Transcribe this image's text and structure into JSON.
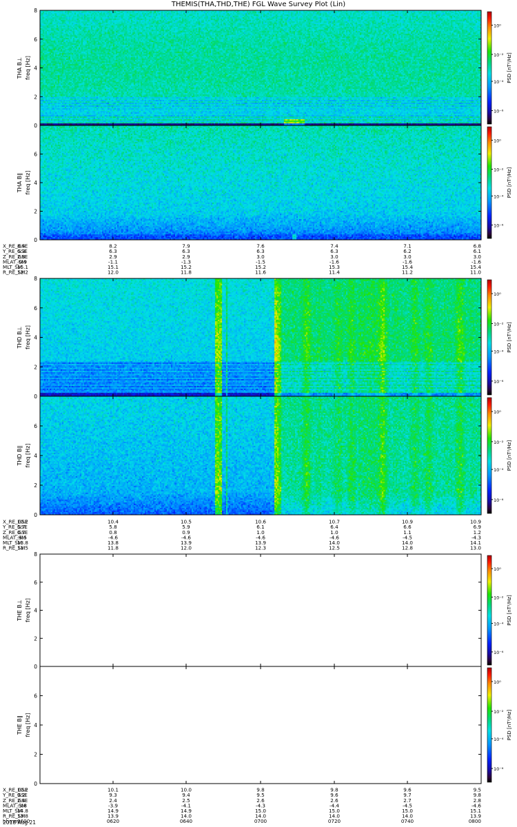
{
  "title": "THEMIS(THA,THD,THE) FGL Wave Survey Plot (Lin)",
  "date_label": "2018 Aug 21",
  "colorbar_label": "PSD [nT²/Hz]",
  "colorbar_ticks": [
    "10⁰",
    "10⁻²",
    "10⁻⁴",
    "10⁻⁶"
  ],
  "chart_data": [
    {
      "type": "heatmap",
      "panel": "THA B⊥",
      "ylabel_top": "THA B⊥",
      "ylabel": "freq [Hz]",
      "ylim": [
        0,
        8
      ],
      "yticks": [
        0,
        2,
        4,
        6,
        8
      ],
      "pattern": "tha_perp",
      "has_data": true
    },
    {
      "type": "heatmap",
      "panel": "THA B∥",
      "ylabel_top": "THA B∥",
      "ylabel": "freq [Hz]",
      "ylim": [
        0,
        8
      ],
      "yticks": [
        0,
        2,
        4,
        6
      ],
      "pattern": "tha_par",
      "has_data": true
    },
    {
      "type": "heatmap",
      "panel": "THD B⊥",
      "ylabel_top": "THD B⊥",
      "ylabel": "freq [Hz]",
      "ylim": [
        0,
        8
      ],
      "yticks": [
        0,
        2,
        4,
        6,
        8
      ],
      "pattern": "thd_perp",
      "has_data": true
    },
    {
      "type": "heatmap",
      "panel": "THD B∥",
      "ylabel_top": "THD B∥",
      "ylabel": "freq [Hz]",
      "ylim": [
        0,
        8
      ],
      "yticks": [
        0,
        2,
        4,
        6
      ],
      "pattern": "thd_par",
      "has_data": true
    },
    {
      "type": "heatmap",
      "panel": "THE B⊥",
      "ylabel_top": "THE B⊥",
      "ylabel": "freq [Hz]",
      "ylim": [
        0,
        8
      ],
      "yticks": [
        0,
        2,
        4,
        6,
        8
      ],
      "pattern": "empty",
      "has_data": false
    },
    {
      "type": "heatmap",
      "panel": "THE B∥",
      "ylabel_top": "THE B∥",
      "ylabel": "freq [Hz]",
      "ylim": [
        0,
        8
      ],
      "yticks": [
        0,
        2,
        4,
        6
      ],
      "pattern": "empty",
      "has_data": false
    }
  ],
  "ephemeris": [
    {
      "rows": [
        {
          "label": "X_RE_GSE",
          "values": [
            "8.4",
            "8.2",
            "7.9",
            "7.6",
            "7.4",
            "7.1",
            "6.8"
          ]
        },
        {
          "label": "Y_RE_GSE",
          "values": [
            "6.3",
            "6.3",
            "6.3",
            "6.3",
            "6.3",
            "6.2",
            "6.1"
          ]
        },
        {
          "label": "Z_RE_GSE",
          "values": [
            "2.8",
            "2.9",
            "2.9",
            "3.0",
            "3.0",
            "3.0",
            "3.0"
          ]
        },
        {
          "label": "MLAT_SM",
          "values": [
            "-0.9",
            "-1.1",
            "-1.3",
            "-1.5",
            "-1.6",
            "-1.6",
            "-1.6"
          ]
        },
        {
          "label": "MLT_SM",
          "values": [
            "15.1",
            "15.1",
            "15.2",
            "15.2",
            "15.3",
            "15.4",
            "15.4"
          ]
        },
        {
          "label": "R_RE_SM",
          "values": [
            "12.2",
            "12.0",
            "11.8",
            "11.6",
            "11.4",
            "11.2",
            "11.0"
          ]
        }
      ]
    },
    {
      "rows": [
        {
          "label": "X_RE_GSE",
          "values": [
            "10.2",
            "10.4",
            "10.5",
            "10.6",
            "10.7",
            "10.9",
            "10.9"
          ]
        },
        {
          "label": "Y_RE_GSE",
          "values": [
            "5.7",
            "5.8",
            "5.9",
            "6.1",
            "6.4",
            "6.6",
            "6.9"
          ]
        },
        {
          "label": "Z_RE_GSE",
          "values": [
            "0.7",
            "0.8",
            "0.9",
            "1.0",
            "1.0",
            "1.1",
            "1.2"
          ]
        },
        {
          "label": "MLAT_SM",
          "values": [
            "-4.5",
            "-4.6",
            "-4.6",
            "-4.6",
            "-4.6",
            "-4.5",
            "-4.3"
          ]
        },
        {
          "label": "MLT_SM",
          "values": [
            "13.8",
            "13.8",
            "13.9",
            "13.9",
            "14.0",
            "14.0",
            "14.1"
          ]
        },
        {
          "label": "R_RE_SM",
          "values": [
            "11.5",
            "11.8",
            "12.0",
            "12.3",
            "12.5",
            "12.8",
            "13.0"
          ]
        }
      ]
    },
    {
      "rows": [
        {
          "label": "X_RE_GSE",
          "values": [
            "10.2",
            "10.1",
            "10.0",
            "9.8",
            "9.8",
            "9.6",
            "9.5"
          ]
        },
        {
          "label": "Y_RE_GSE",
          "values": [
            "9.2",
            "9.3",
            "9.4",
            "9.5",
            "9.6",
            "9.7",
            "9.8"
          ]
        },
        {
          "label": "Z_RE_GSE",
          "values": [
            "2.4",
            "2.4",
            "2.5",
            "2.6",
            "2.6",
            "2.7",
            "2.8"
          ]
        },
        {
          "label": "MLAT_SM",
          "values": [
            "-3.8",
            "-3.9",
            "-4.1",
            "-4.3",
            "-4.4",
            "-4.5",
            "-4.6"
          ]
        },
        {
          "label": "MLT_SM",
          "values": [
            "14.8",
            "14.9",
            "14.9",
            "15.0",
            "15.0",
            "15.0",
            "15.1"
          ]
        },
        {
          "label": "R_RE_SM",
          "values": [
            "13.8",
            "13.9",
            "14.0",
            "14.0",
            "14.0",
            "14.0",
            "13.9"
          ]
        },
        {
          "label": "hhmm",
          "values": [
            "0600",
            "0620",
            "0640",
            "0700",
            "0720",
            "0740",
            "0800"
          ]
        }
      ]
    }
  ]
}
